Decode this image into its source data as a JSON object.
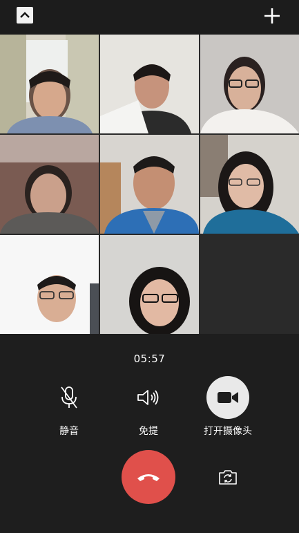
{
  "call": {
    "timer": "05:57",
    "controls": [
      {
        "label": "静音",
        "icon": "microphone-icon"
      },
      {
        "label": "免提",
        "icon": "speaker-icon"
      },
      {
        "label": "打开摄像头",
        "icon": "video-camera-icon"
      }
    ],
    "hangup_icon": "phone-hangup-icon",
    "switch_camera_icon": "camera-switch-icon"
  },
  "topbar": {
    "collapse_icon": "chevron-up-icon",
    "add_icon": "plus-icon"
  },
  "participants_count": 8,
  "colors": {
    "background": "#1f1f1f",
    "hangup": "#e0504b",
    "camera_button": "#e9e9e9"
  }
}
